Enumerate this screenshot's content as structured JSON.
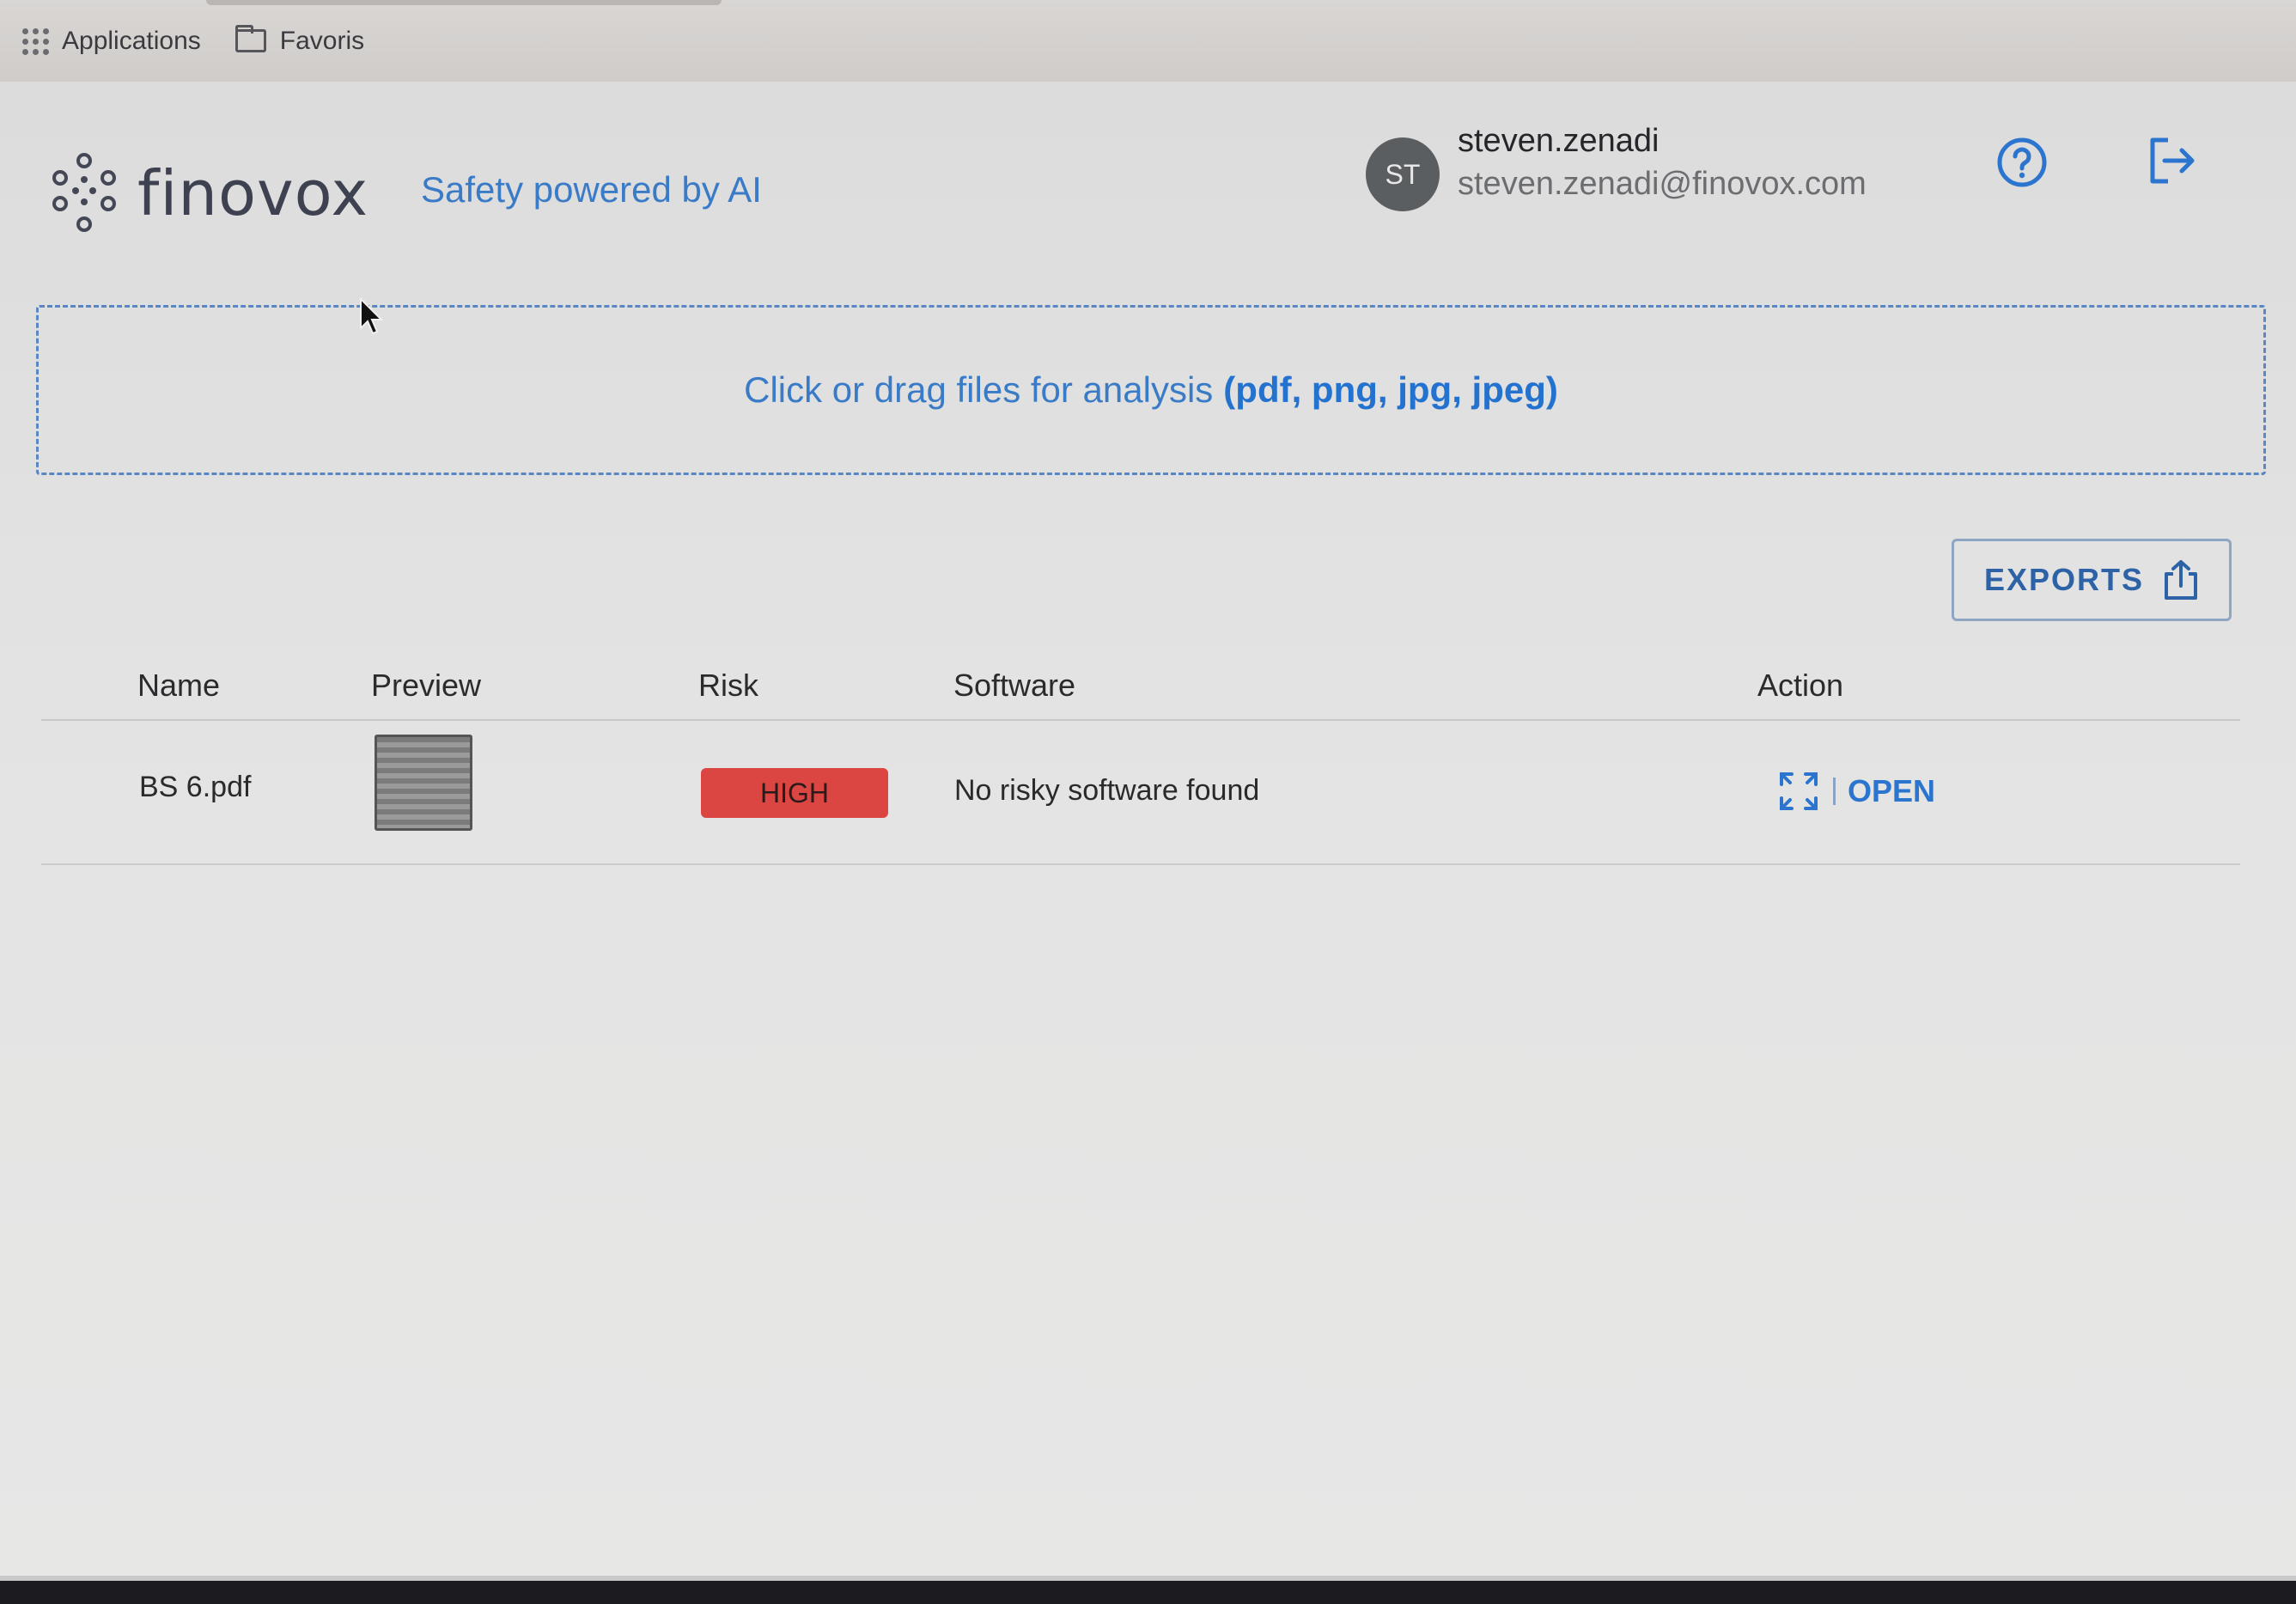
{
  "browser": {
    "bookmarks": [
      {
        "label": "Applications",
        "icon": "apps-grid-icon"
      },
      {
        "label": "Favoris",
        "icon": "folder-icon"
      }
    ]
  },
  "header": {
    "logo_text": "finovox",
    "tagline": "Safety powered by AI",
    "user": {
      "initials": "ST",
      "name": "steven.zenadi",
      "email": "steven.zenadi@finovox.com"
    },
    "help_icon": "help-circle-icon",
    "logout_icon": "logout-icon"
  },
  "dropzone": {
    "text": "Click or drag files for analysis",
    "formats": "(pdf, png, jpg, jpeg)"
  },
  "toolbar": {
    "exports_label": "EXPORTS",
    "exports_icon": "share-upload-icon"
  },
  "table": {
    "columns": [
      "Name",
      "Preview",
      "Risk",
      "Software",
      "Action"
    ],
    "rows": [
      {
        "name": "BS 6.pdf",
        "risk": "HIGH",
        "software": "No risky software found",
        "action": "OPEN"
      }
    ]
  },
  "colors": {
    "accent": "#2b75cf",
    "risk_high": "#dc4642",
    "text": "#2a2a2d"
  }
}
